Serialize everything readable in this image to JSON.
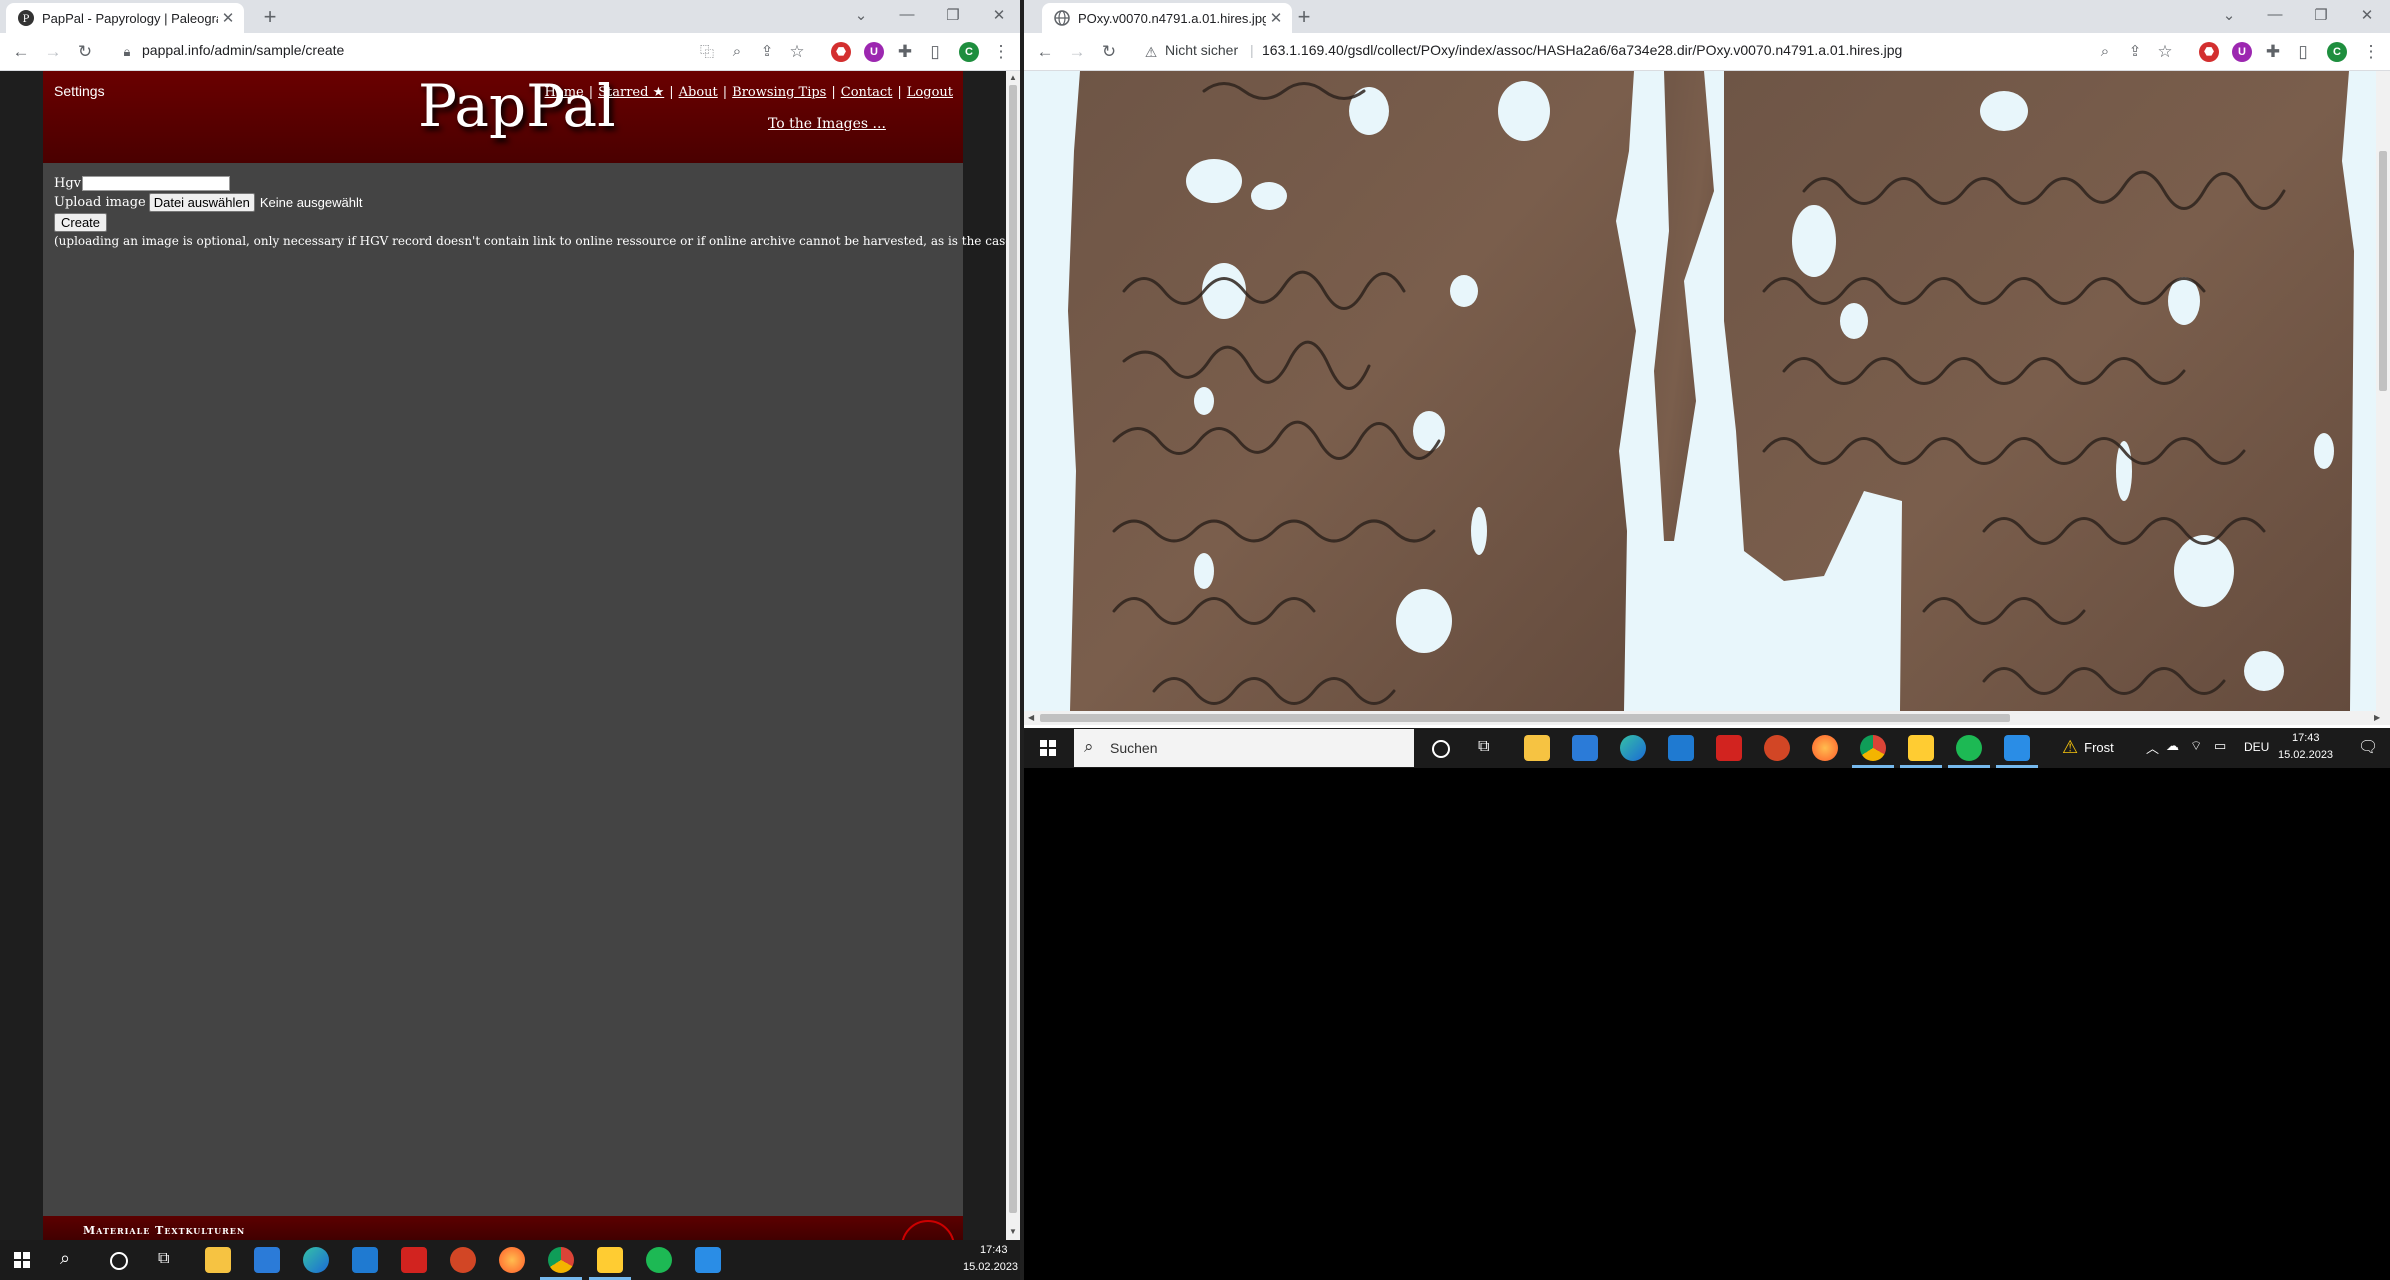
{
  "left_browser": {
    "tab": {
      "title": "PapPal - Papyrology | Paleography",
      "favicon": "pappal-favicon"
    },
    "url": "pappal.info/admin/sample/create",
    "colors": {
      "page_bg": "#444444",
      "header_bg": "#5c0000",
      "sidebar": "#1e1e1e"
    }
  },
  "pappal": {
    "settings_label": "Settings",
    "logo": "PapPal",
    "nav": [
      {
        "label": "Home"
      },
      {
        "label": "Starred ★"
      },
      {
        "label": "About"
      },
      {
        "label": "Browsing Tips"
      },
      {
        "label": "Contact"
      },
      {
        "label": "Logout"
      }
    ],
    "to_images": "To the Images ...",
    "form": {
      "hgv_label": "Hgv",
      "hgv_value": "",
      "upload_label": "Upload image",
      "file_button": "Datei auswählen",
      "file_status": "Keine ausgewählt",
      "create_button": "Create",
      "note": "(uploading an image is optional, only necessary if HGV record doesn't contain link to online ressource or if online archive cannot be harvested, as is the case for ONB)"
    },
    "footer_text": "Materiale Textkulturen"
  },
  "right_browser": {
    "tab": {
      "title": "POxy.v0070.n4791.a.01.hires.jpg",
      "favicon": "globe-icon"
    },
    "security_label": "Nicht sicher",
    "url": "163.1.169.40/gsdl/collect/POxy/index/assoc/HASHa2a6/6a734e28.dir/POxy.v0070.n4791.a.01.hires.jpg",
    "image_alt": "Papyrus fragment POxy 4791 (placeholder rendering)"
  },
  "taskbar_right": {
    "search_placeholder": "Suchen",
    "weather": "Frost",
    "language": "DEU",
    "time": "17:43",
    "date": "15.02.2023",
    "accent": "#76b9ed"
  },
  "taskbar_left": {
    "time": "17:43",
    "date": "15.02.2023"
  },
  "icons": {
    "profile_initial": "C",
    "accent_green": "#1e8e3e"
  }
}
